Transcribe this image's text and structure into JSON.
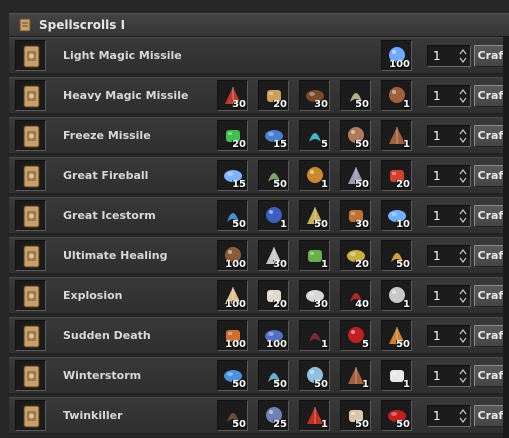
{
  "window": {
    "title": "Spellscrolls I"
  },
  "craft_label": "Craft",
  "rows": [
    {
      "name": "Light Magic Missile",
      "qty": "1",
      "materials": [
        {
          "icon": "blue-crystal-pile-icon",
          "count": "100",
          "color": "#6fa8ff"
        }
      ]
    },
    {
      "name": "Heavy Magic Missile",
      "qty": "1",
      "materials": [
        {
          "icon": "red-heart-icon",
          "count": "30",
          "color": "#c0392b"
        },
        {
          "icon": "torch-icon",
          "count": "20",
          "color": "#c9a15a"
        },
        {
          "icon": "wooden-stump-icon",
          "count": "30",
          "color": "#7a4a28"
        },
        {
          "icon": "bone-claw-icon",
          "count": "50",
          "color": "#b5b08a"
        },
        {
          "icon": "small-scroll-icon",
          "count": "1",
          "color": "#a06040"
        }
      ]
    },
    {
      "name": "Freeze Missile",
      "qty": "1",
      "materials": [
        {
          "icon": "green-leaves-icon",
          "count": "20",
          "color": "#3fbf4f"
        },
        {
          "icon": "blue-wand-icon",
          "count": "15",
          "color": "#4a7fd0"
        },
        {
          "icon": "blue-gem-cluster-icon",
          "count": "5",
          "color": "#3fb7c7"
        },
        {
          "icon": "mushroom-icon",
          "count": "50",
          "color": "#b07a5a"
        },
        {
          "icon": "small-scroll-icon",
          "count": "1",
          "color": "#a06040"
        }
      ]
    },
    {
      "name": "Great Fireball",
      "qty": "1",
      "materials": [
        {
          "icon": "blue-crystal-shard-icon",
          "count": "15",
          "color": "#7fb3ff"
        },
        {
          "icon": "green-feather-icon",
          "count": "50",
          "color": "#7fa070"
        },
        {
          "icon": "amber-egg-icon",
          "count": "1",
          "color": "#c88a2a"
        },
        {
          "icon": "grey-stone-icon",
          "count": "50",
          "color": "#9a9ab0"
        },
        {
          "icon": "red-skull-icon",
          "count": "20",
          "color": "#d04030"
        }
      ]
    },
    {
      "name": "Great Icestorm",
      "qty": "1",
      "materials": [
        {
          "icon": "blue-tooth-icon",
          "count": "50",
          "color": "#4a8fd0"
        },
        {
          "icon": "blue-claw-icon",
          "count": "1",
          "color": "#3a5fc0"
        },
        {
          "icon": "yellow-fang-icon",
          "count": "50",
          "color": "#c8b060"
        },
        {
          "icon": "orange-branch-icon",
          "count": "30",
          "color": "#c07030"
        },
        {
          "icon": "blue-crystal-icon",
          "count": "10",
          "color": "#6fb0ff"
        }
      ]
    },
    {
      "name": "Ultimate Healing",
      "qty": "1",
      "materials": [
        {
          "icon": "brown-root-icon",
          "count": "100",
          "color": "#8a5a3a"
        },
        {
          "icon": "goat-head-icon",
          "count": "30",
          "color": "#c8c8c8"
        },
        {
          "icon": "green-horn-icon",
          "count": "1",
          "color": "#6ab04a"
        },
        {
          "icon": "yellow-worm-icon",
          "count": "20",
          "color": "#c8b040"
        },
        {
          "icon": "golden-harp-icon",
          "count": "50",
          "color": "#d0a040"
        }
      ]
    },
    {
      "name": "Explosion",
      "qty": "1",
      "materials": [
        {
          "icon": "sun-emblem-icon",
          "count": "100",
          "color": "#e0c090"
        },
        {
          "icon": "white-tusk-icon",
          "count": "20",
          "color": "#e0d8c8"
        },
        {
          "icon": "white-hook-icon",
          "count": "30",
          "color": "#d8d8d8"
        },
        {
          "icon": "red-pouch-icon",
          "count": "40",
          "color": "#b02828"
        },
        {
          "icon": "silver-cluster-icon",
          "count": "1",
          "color": "#c8c8c8"
        }
      ]
    },
    {
      "name": "Sudden Death",
      "qty": "1",
      "materials": [
        {
          "icon": "orange-mushroom-icon",
          "count": "100",
          "color": "#d07030"
        },
        {
          "icon": "dark-gear-icon",
          "count": "100",
          "color": "#5070c0"
        },
        {
          "icon": "dark-heart-icon",
          "count": "1",
          "color": "#7a2a3a"
        },
        {
          "icon": "red-claws-icon",
          "count": "5",
          "color": "#c02020"
        },
        {
          "icon": "eye-icon",
          "count": "50",
          "color": "#d08030"
        }
      ]
    },
    {
      "name": "Winterstorm",
      "qty": "1",
      "materials": [
        {
          "icon": "ice-shard-icon",
          "count": "50",
          "color": "#4a90e0"
        },
        {
          "icon": "snowball-icon",
          "count": "50",
          "color": "#6ab0d0"
        },
        {
          "icon": "ice-crystal-icon",
          "count": "50",
          "color": "#90c0e0"
        },
        {
          "icon": "small-scroll-icon",
          "count": "1",
          "color": "#a06040"
        },
        {
          "icon": "white-feather-icon",
          "count": "1",
          "color": "#e8e8e8"
        }
      ]
    },
    {
      "name": "Twinkiller",
      "qty": "1",
      "materials": [
        {
          "icon": "dark-wing-icon",
          "count": "50",
          "color": "#6a4a3a"
        },
        {
          "icon": "blue-orb-icon",
          "count": "25",
          "color": "#7080b0"
        },
        {
          "icon": "red-dragon-icon",
          "count": "1",
          "color": "#c03020"
        },
        {
          "icon": "bone-icon",
          "count": "50",
          "color": "#d8c8a8"
        },
        {
          "icon": "red-tail-icon",
          "count": "50",
          "color": "#c02020"
        }
      ]
    }
  ]
}
